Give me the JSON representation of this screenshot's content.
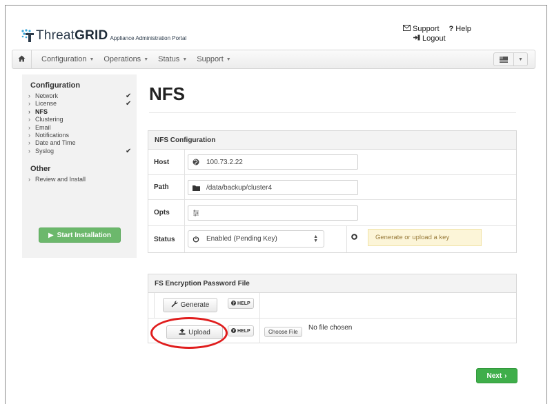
{
  "header": {
    "logo_prefix": "Threat",
    "logo_grid": "GRID",
    "logo_subtitle": "Appliance Administration Portal",
    "support_label": "Support",
    "help_label": "Help",
    "logout_label": "Logout"
  },
  "navbar": {
    "items": [
      {
        "label": "Configuration"
      },
      {
        "label": "Operations"
      },
      {
        "label": "Status"
      },
      {
        "label": "Support"
      }
    ]
  },
  "sidebar": {
    "configuration_heading": "Configuration",
    "items": [
      {
        "label": "Network",
        "checked": true
      },
      {
        "label": "License",
        "checked": true
      },
      {
        "label": "NFS",
        "active": true
      },
      {
        "label": "Clustering"
      },
      {
        "label": "Email"
      },
      {
        "label": "Notifications"
      },
      {
        "label": "Date and Time"
      },
      {
        "label": "Syslog",
        "checked": true
      }
    ],
    "other_heading": "Other",
    "other_items": [
      {
        "label": "Review and Install"
      }
    ],
    "start_button": "Start Installation"
  },
  "main": {
    "title": "NFS",
    "nfs_panel": {
      "heading": "NFS Configuration",
      "host_label": "Host",
      "host_value": "100.73.2.22",
      "path_label": "Path",
      "path_value": "/data/backup/cluster4",
      "opts_label": "Opts",
      "opts_value": "",
      "status_label": "Status",
      "status_value": "Enabled (Pending Key)",
      "key_hint": "Generate or upload a key"
    },
    "fs_panel": {
      "heading": "FS Encryption Password File",
      "generate_button": "Generate",
      "help_label": "HELP",
      "upload_button": "Upload",
      "choose_file_button": "Choose File",
      "no_file_text": "No file chosen"
    },
    "next_button": "Next"
  },
  "colors": {
    "start_green": "#6cb86c",
    "next_green": "#3fae4a",
    "highlight_red": "#e01d1d",
    "hint_background": "#fcf5d8"
  }
}
